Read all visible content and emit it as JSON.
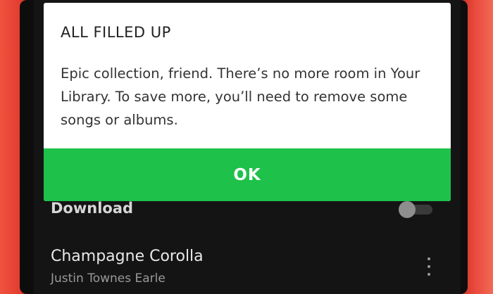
{
  "dialog": {
    "title": "ALL FILLED UP",
    "message": "Epic collection, friend. There’s no more room in Your Library. To save more, you’ll need to remove some songs or albums.",
    "ok_label": "OK"
  },
  "library": {
    "download_label": "Download",
    "download_enabled": false,
    "song": {
      "title": "Champagne Corolla",
      "artist": "Justin Townes Earle"
    }
  },
  "colors": {
    "accent": "#1ec14a",
    "phone_case": "#e9483a",
    "dialog_background": "#ffffff",
    "screen_background": "#141414"
  },
  "icons": [
    "more-vertical-icon"
  ]
}
